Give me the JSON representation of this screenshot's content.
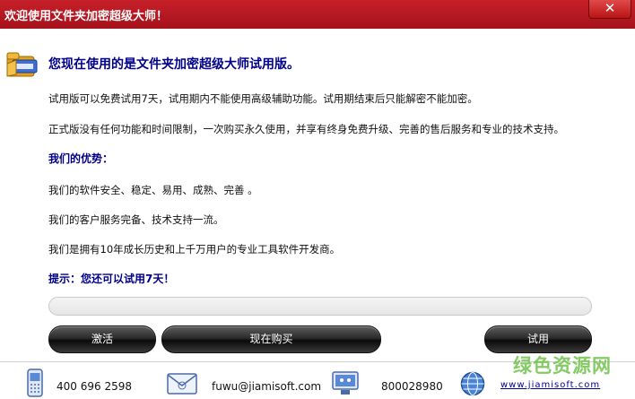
{
  "window": {
    "title": "欢迎使用文件夹加密超级大师！",
    "close_label": "✕"
  },
  "content": {
    "heading": "您现在使用的是文件夹加密超级大师试用版。",
    "trial_note": "试用版可以免费试用7天，试用期内不能使用高级辅助功能。试用期结束后只能解密不能加密。",
    "full_note": "正式版没有任何功能和时间限制，一次购买永久使用，并享有终身免费升级、完善的售后服务和专业的技术支持。",
    "advantages_heading": "我们的优势：",
    "advantages": [
      "我们的软件安全、稳定、易用、成熟、完善 。",
      "我们的客户服务完备、技术支持一流。",
      "我们是拥有10年成长历史和上千万用户的专业工具软件开发商。"
    ],
    "hint": "提示：您还可以试用7天！",
    "progress_percent": 0
  },
  "buttons": {
    "activate": "激活",
    "buy": "现在购买",
    "trial": "试用"
  },
  "footer": {
    "phone": "400 696 2598",
    "email": "fuwu@jiamisoft.com",
    "qq": "800028980",
    "website": "www.jiamisoft.com",
    "watermark": "绿色资源网"
  },
  "colors": {
    "titlebar": "#c7202a",
    "heading": "#00008b",
    "watermark": "#6fc24a"
  }
}
